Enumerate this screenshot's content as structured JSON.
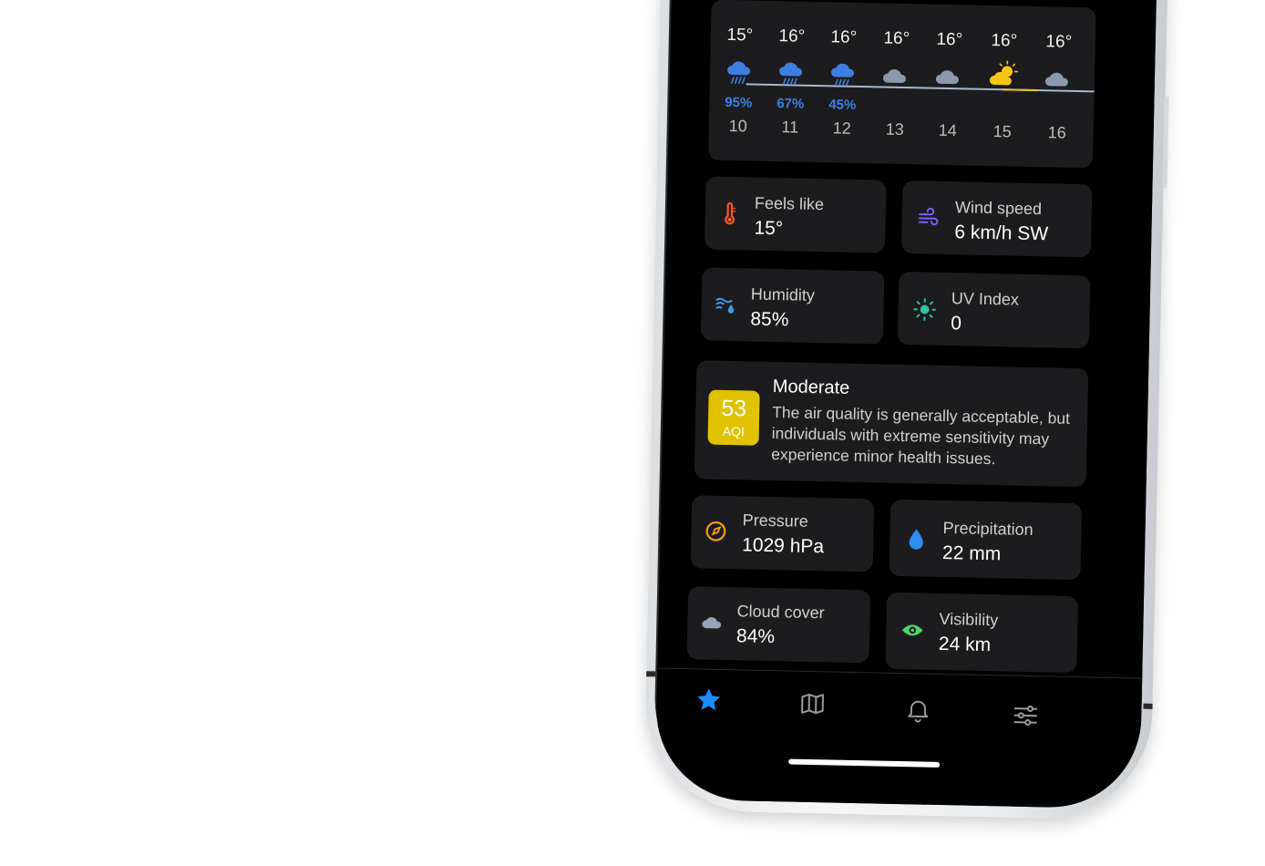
{
  "hourly": [
    {
      "temp": "15°",
      "pct": "95%",
      "hour": "10",
      "icon": "rain-cloud-icon"
    },
    {
      "temp": "16°",
      "pct": "67%",
      "hour": "11",
      "icon": "rain-cloud-icon"
    },
    {
      "temp": "16°",
      "pct": "45%",
      "hour": "12",
      "icon": "rain-cloud-icon"
    },
    {
      "temp": "16°",
      "pct": "",
      "hour": "13",
      "icon": "cloud-icon"
    },
    {
      "temp": "16°",
      "pct": "",
      "hour": "14",
      "icon": "cloud-icon"
    },
    {
      "temp": "16°",
      "pct": "",
      "hour": "15",
      "icon": "partly-sunny-icon"
    },
    {
      "temp": "16°",
      "pct": "",
      "hour": "16",
      "icon": "cloud-icon"
    }
  ],
  "stats": {
    "feels_like": {
      "label": "Feels like",
      "value": "15°",
      "icon": "thermometer-icon"
    },
    "wind_speed": {
      "label": "Wind speed",
      "value": "6 km/h SW",
      "icon": "wind-icon"
    },
    "humidity": {
      "label": "Humidity",
      "value": "85%",
      "icon": "humidity-icon"
    },
    "uv_index": {
      "label": "UV Index",
      "value": "0",
      "icon": "sun-icon"
    },
    "pressure": {
      "label": "Pressure",
      "value": "1029 hPa",
      "icon": "gauge-icon"
    },
    "precipitation": {
      "label": "Precipitation",
      "value": "22 mm",
      "icon": "droplet-icon"
    },
    "cloud_cover": {
      "label": "Cloud cover",
      "value": "84%",
      "icon": "cloud-icon"
    },
    "visibility": {
      "label": "Visibility",
      "value": "24 km",
      "icon": "eye-icon"
    }
  },
  "aqi": {
    "value": "53",
    "unit": "AQI",
    "level": "Moderate",
    "description": "The air quality is generally acceptable, but individuals with extreme sensitivity may experience minor health issues."
  },
  "tabs": [
    "star-icon",
    "map-icon",
    "bell-icon",
    "sliders-icon"
  ],
  "colors": {
    "background": "#000000",
    "card": "#1c1c1e",
    "accent": "#1a8cff",
    "rain": "#3d7fe0",
    "aqi_moderate": "#e0c200",
    "sun": "#f5c518",
    "uv": "#2ec4a0",
    "visibility": "#4cd964",
    "pressure": "#ff9f0a",
    "thermometer": "#ff5a2a",
    "wind": "#7b61ff"
  }
}
